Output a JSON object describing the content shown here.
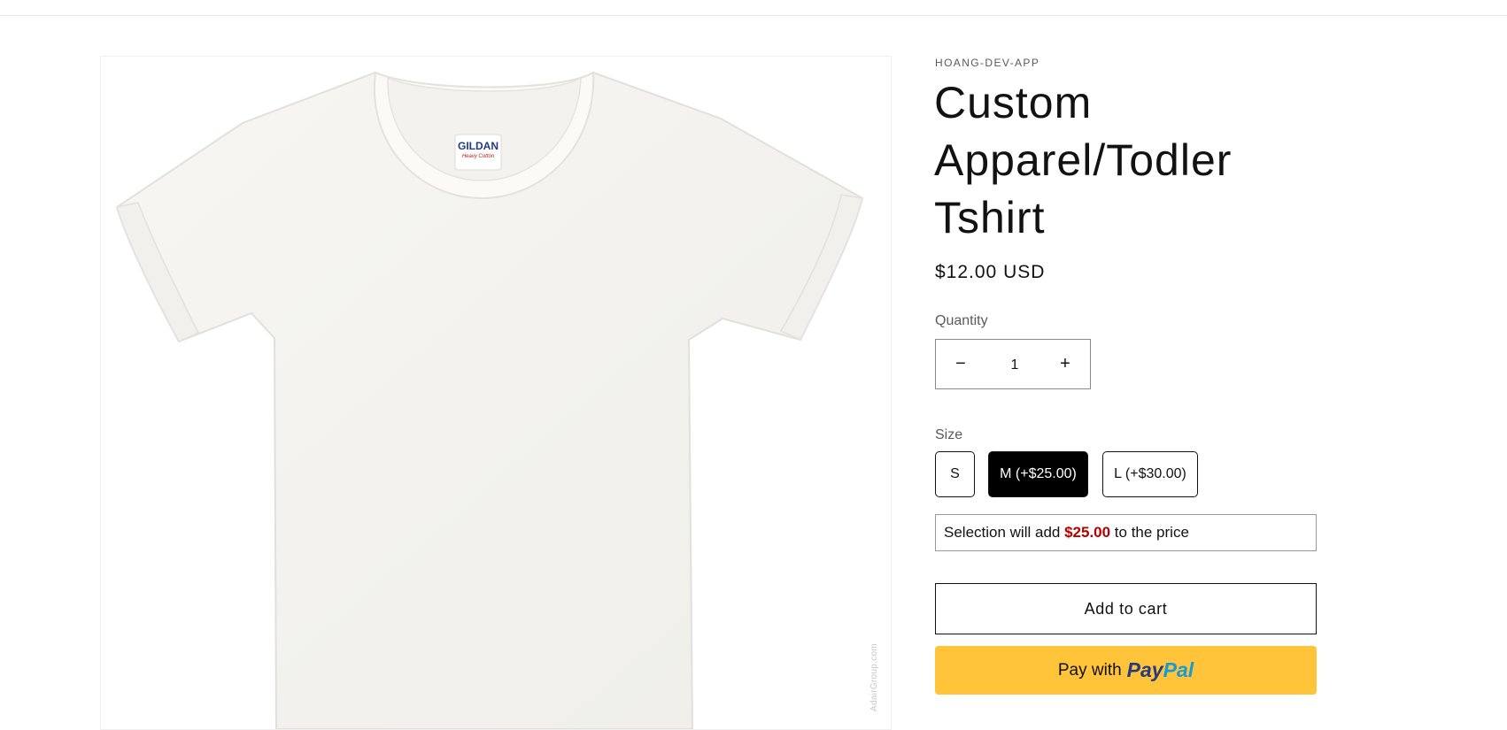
{
  "product": {
    "vendor": "HOANG-DEV-APP",
    "title": "Custom Apparel/Todler Tshirt",
    "price": "$12.00 USD",
    "image_label_brand": "GILDAN",
    "image_label_sub": "Heavy Cotton",
    "image_watermark": "AdairGroup.com"
  },
  "quantity": {
    "label": "Quantity",
    "value": "1",
    "decrease_symbol": "−",
    "increase_symbol": "+"
  },
  "size": {
    "label": "Size",
    "options": [
      {
        "label": "S",
        "selected": false
      },
      {
        "label": "M (+$25.00)",
        "selected": true
      },
      {
        "label": "L (+$30.00)",
        "selected": false
      }
    ]
  },
  "selection_note": {
    "prefix": "Selection will add ",
    "amount": "$25.00",
    "suffix": " to the price",
    "amount_color": "#b30000"
  },
  "buttons": {
    "add_to_cart": "Add to cart",
    "pay_with": "Pay with",
    "paypal_part1": "Pay",
    "paypal_part2": "Pal"
  },
  "colors": {
    "paypal_yellow": "#ffc439",
    "selected_size_bg": "#000000"
  }
}
